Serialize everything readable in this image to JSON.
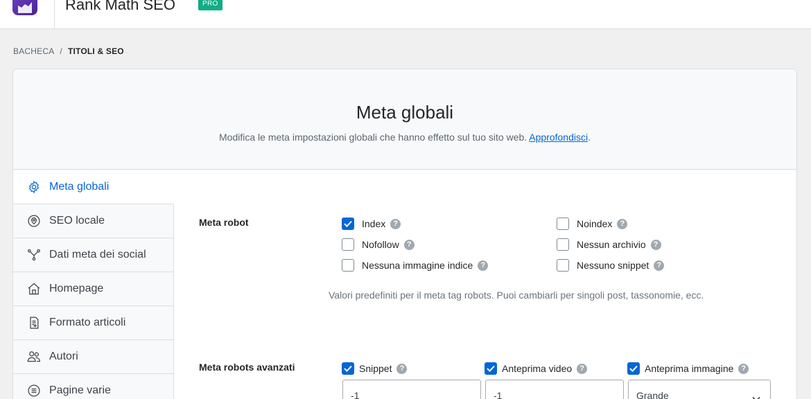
{
  "header": {
    "brand": "Rank Math SEO",
    "badge": "PRO",
    "logo_icon": "rank-math-logo",
    "accent": "#0366d6",
    "badge_color": "#10ac84"
  },
  "breadcrumb": {
    "root": "BACHECA",
    "separator": "/",
    "current": "TITOLI & SEO"
  },
  "page": {
    "title": "Meta globali",
    "description": "Modifica le meta impostazioni globali che hanno effetto sul tuo sito web.",
    "learn_more": "Approfondisci",
    "trailing": "."
  },
  "sidebar": {
    "items": [
      {
        "label": "Meta globali",
        "icon": "gear-icon",
        "active": true
      },
      {
        "label": "SEO locale",
        "icon": "map-pin-icon",
        "active": false
      },
      {
        "label": "Dati meta dei social",
        "icon": "share-icon",
        "active": false
      },
      {
        "label": "Homepage",
        "icon": "home-icon",
        "active": false
      },
      {
        "label": "Formato articoli",
        "icon": "document-icon",
        "active": false
      },
      {
        "label": "Autori",
        "icon": "users-icon",
        "active": false
      },
      {
        "label": "Pagine varie",
        "icon": "list-circle-icon",
        "active": false
      }
    ]
  },
  "robots": {
    "label": "Meta robot",
    "options": [
      {
        "label": "Index",
        "checked": true
      },
      {
        "label": "Noindex",
        "checked": false
      },
      {
        "label": "Nofollow",
        "checked": false
      },
      {
        "label": "Nessun archivio",
        "checked": false
      },
      {
        "label": "Nessuna immagine indice",
        "checked": false
      },
      {
        "label": "Nessuno snippet",
        "checked": false
      }
    ],
    "hint": "Valori predefiniti per il meta tag robots. Puoi cambiarli per singoli post, tassonomie, ecc."
  },
  "advanced": {
    "label": "Meta robots avanzati",
    "options": [
      {
        "label": "Snippet",
        "checked": true,
        "value": "-1"
      },
      {
        "label": "Anteprima video",
        "checked": true,
        "value": "-1"
      },
      {
        "label": "Anteprima immagine",
        "checked": true,
        "value": "Grande"
      }
    ]
  },
  "help_glyph": "?"
}
